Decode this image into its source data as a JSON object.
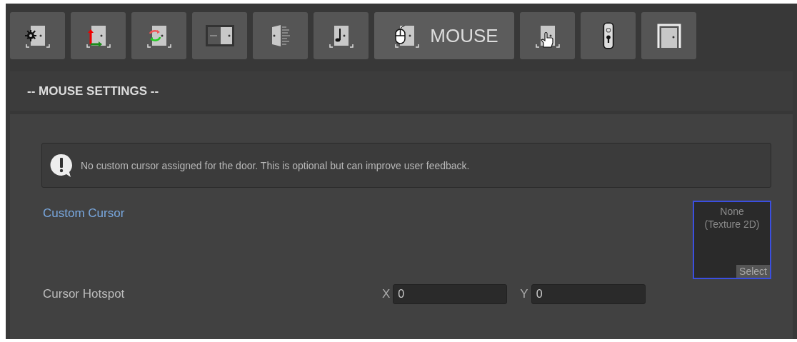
{
  "toolbar": [
    {
      "kind": "gear",
      "selected": false
    },
    {
      "kind": "arrows",
      "selected": false
    },
    {
      "kind": "cycle",
      "selected": false
    },
    {
      "kind": "slide",
      "selected": false
    },
    {
      "kind": "open",
      "selected": false
    },
    {
      "kind": "note",
      "selected": false
    },
    {
      "kind": "mouse",
      "selected": true,
      "label": "MOUSE"
    },
    {
      "kind": "hand",
      "selected": false
    },
    {
      "kind": "lock",
      "selected": false
    },
    {
      "kind": "frame",
      "selected": false
    }
  ],
  "section": {
    "title": "-- MOUSE SETTINGS --",
    "notice": "No custom cursor assigned for the door. This is optional but can improve user feedback.",
    "custom_cursor": {
      "label": "Custom Cursor",
      "value": "None\n(Texture 2D)",
      "button": "Select"
    },
    "cursor_hotspot": {
      "label": "Cursor Hotspot",
      "x_label": "X",
      "x_value": "0",
      "y_label": "Y",
      "y_value": "0"
    }
  }
}
